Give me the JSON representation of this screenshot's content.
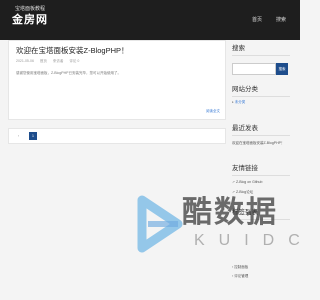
{
  "header": {
    "logo_subtitle": "宝塔面板教程",
    "logo_title": "金房网",
    "nav": [
      {
        "label": "首页"
      },
      {
        "label": "搜索"
      }
    ]
  },
  "post": {
    "title": "欢迎在宝塔面板安装Z-BlogPHP！",
    "meta": {
      "date": "2021-05-06",
      "category": "首页",
      "author": "来访者",
      "comments": "评论 0"
    },
    "excerpt": "感谢您使用宝塔面板，Z-BlogPHP已安装完毕，您可以开始使用了。",
    "more_label": "阅读全文"
  },
  "pagination": {
    "prev": "‹",
    "current": "1"
  },
  "sidebar": {
    "search": {
      "title": "搜索",
      "button": "搜索"
    },
    "categories": {
      "title": "网站分类",
      "items": [
        "未分类"
      ]
    },
    "recent": {
      "title": "最近发表",
      "items": [
        "欢迎在宝塔面板安装Z-BlogPHP！"
      ]
    },
    "links": {
      "title": "友情链接",
      "items": [
        "Z-Blog on Github",
        "Z-Blog论坛"
      ]
    },
    "tags": {
      "title": "标签列表"
    },
    "extra": {
      "items": [
        "控制面板",
        "评论管理"
      ]
    }
  },
  "watermark": {
    "main": "酷数据",
    "latin": "KUIDC"
  }
}
